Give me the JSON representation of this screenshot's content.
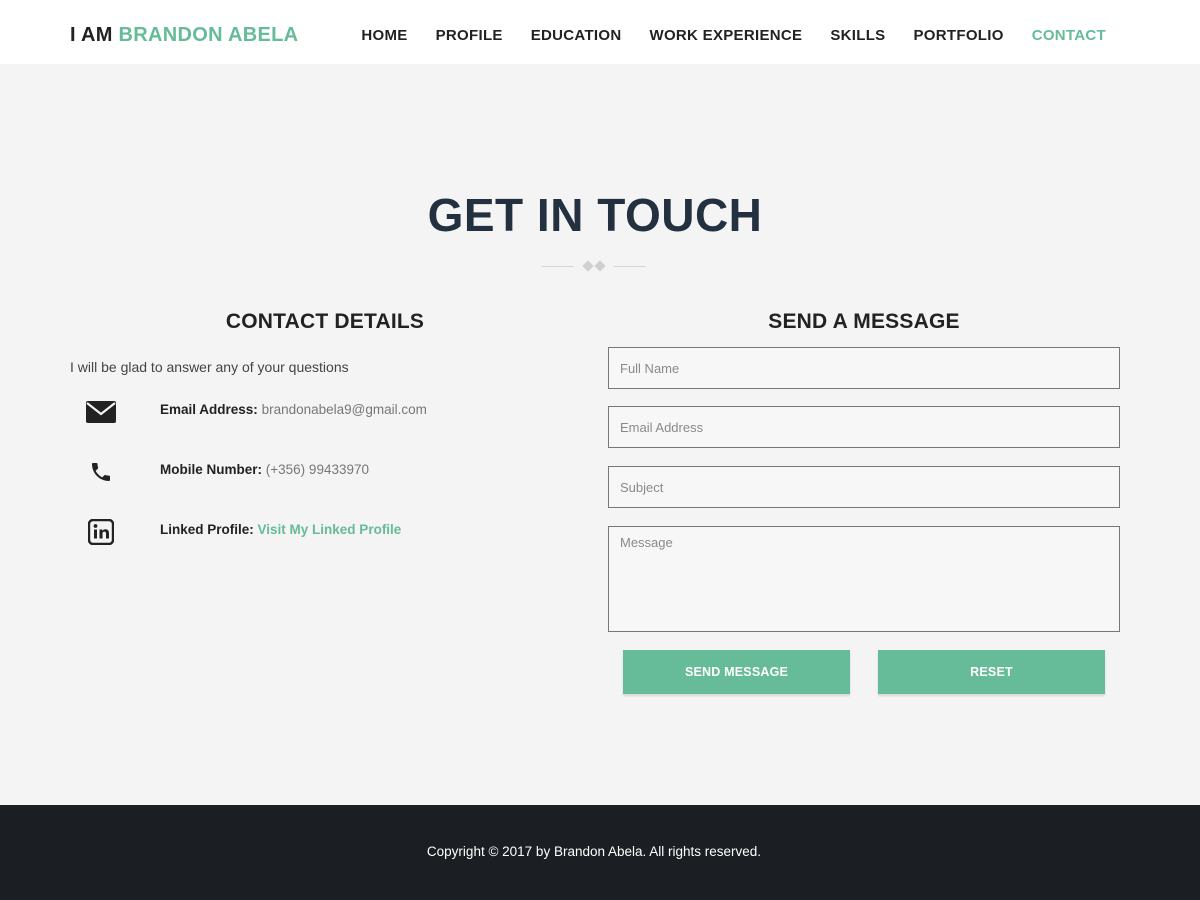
{
  "header": {
    "brand_prefix": "I AM ",
    "brand_name": "BRANDON ABELA",
    "nav": [
      "HOME",
      "PROFILE",
      "EDUCATION",
      "WORK EXPERIENCE",
      "SKILLS",
      "PORTFOLIO",
      "CONTACT"
    ],
    "active_nav": "CONTACT"
  },
  "section": {
    "title": "GET IN TOUCH"
  },
  "contact_details": {
    "title": "CONTACT DETAILS",
    "intro": "I will be glad to answer any of your questions",
    "email_label": "Email Address:",
    "email_value": "brandonabela9@gmail.com",
    "mobile_label": "Mobile Number:",
    "mobile_value": "(+356) 99433970",
    "linkedin_label": "Linked Profile:",
    "linkedin_value": "Visit My Linked Profile",
    "icons": [
      "envelope-icon",
      "phone-icon",
      "linkedin-icon"
    ]
  },
  "form": {
    "title": "SEND A MESSAGE",
    "full_name_placeholder": "Full Name",
    "email_placeholder": "Email Address",
    "subject_placeholder": "Subject",
    "message_placeholder": "Message",
    "send_label": "SEND MESSAGE",
    "reset_label": "RESET"
  },
  "footer": {
    "copyright": "Copyright © 2017 by Brandon Abela. All rights reserved."
  },
  "colors": {
    "accent": "#66bb98",
    "heading": "#22303f",
    "footer_bg": "#1b1e22",
    "page_bg": "#f4f4f4"
  }
}
